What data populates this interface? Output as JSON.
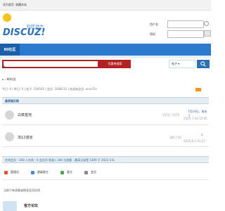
{
  "topbar": {
    "set_home": "设为首页",
    "bookmark": "收藏本站"
  },
  "logo": {
    "slogan": "社区动力",
    "wordmark": "DISCUZ!"
  },
  "login": {
    "username_label": "用户名",
    "password_label": "密码"
  },
  "nav": {
    "active_tab": "80社区"
  },
  "search": {
    "button": "优惠券搜索",
    "hot_label": "热",
    "select": "帖子 ▾"
  },
  "breadcrumb": {
    "home": "⌂",
    "sep": "›",
    "current": "80社区"
  },
  "stats": {
    "text": "今日: 0 | 昨日: 0 | 帖子: 159505 | 会员: 1648131 | 欢迎新会员: anneTix"
  },
  "section": {
    "title": "悬赏猫乐购"
  },
  "forums": [
    {
      "name": "白菜基地",
      "count": "1575 / 1575",
      "last_title": "7月19日，周末了",
      "last_time": "2025-7-19 15:40"
    },
    {
      "name": "淘12通道",
      "count": "385 / 50",
      "last_title": "1",
      "last_time": "2025-6-1 01:37"
    }
  ],
  "online": {
    "title": "在线会员 - 340 人在线 - 0 会员(0 隐身), 340 位游客 - 最高记录是 5309 于 2021-3-6."
  },
  "legend": [
    {
      "label": "管理员",
      "color": "#e0512d"
    },
    {
      "label": "超级版主",
      "color": "#4d8ad6"
    },
    {
      "label": "版主",
      "color": "#49a84a"
    },
    {
      "label": "会员",
      "color": "#8a8a8a"
    }
  ],
  "online_note": "当前只有游客或隐身会员在线",
  "footer": {
    "title": "官方论坛"
  }
}
